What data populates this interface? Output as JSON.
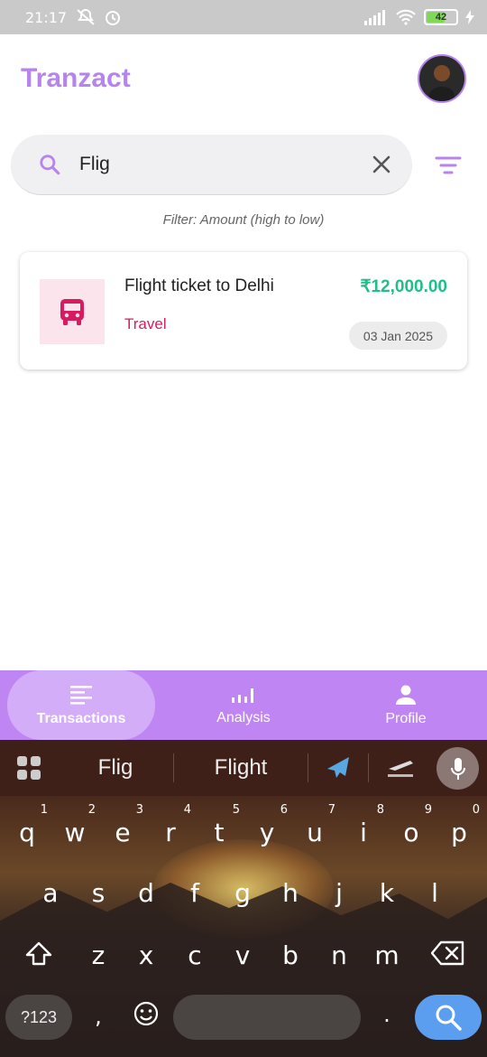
{
  "status_bar": {
    "time": "21:17",
    "battery": "42"
  },
  "header": {
    "title": "Tranzact"
  },
  "search": {
    "value": "Flig"
  },
  "filter_label": "Filter: Amount (high to low)",
  "transactions": [
    {
      "title": "Flight ticket to Delhi",
      "category": "Travel",
      "amount": "₹12,000.00",
      "date": "03 Jan 2025",
      "icon": "bus-icon"
    }
  ],
  "colors": {
    "accent": "#b784ee",
    "nav_bg": "#bf86f3",
    "amount": "#1fbf8a",
    "category": "#d81b60"
  },
  "bottom_nav": {
    "items": [
      {
        "label": "Transactions",
        "icon": "list-icon",
        "active": true
      },
      {
        "label": "Analysis",
        "icon": "bar-chart-icon",
        "active": false
      },
      {
        "label": "Profile",
        "icon": "person-icon",
        "active": false
      }
    ]
  },
  "keyboard": {
    "suggestions": [
      "Flig",
      "Flight"
    ],
    "row1": [
      "q",
      "w",
      "e",
      "r",
      "t",
      "y",
      "u",
      "i",
      "o",
      "p"
    ],
    "row1_nums": [
      "1",
      "2",
      "3",
      "4",
      "5",
      "6",
      "7",
      "8",
      "9",
      "0"
    ],
    "row2": [
      "a",
      "s",
      "d",
      "f",
      "g",
      "h",
      "j",
      "k",
      "l"
    ],
    "row3": [
      "z",
      "x",
      "c",
      "v",
      "b",
      "n",
      "m"
    ],
    "symbols_label": "?123",
    "comma": ",",
    "period": "."
  }
}
